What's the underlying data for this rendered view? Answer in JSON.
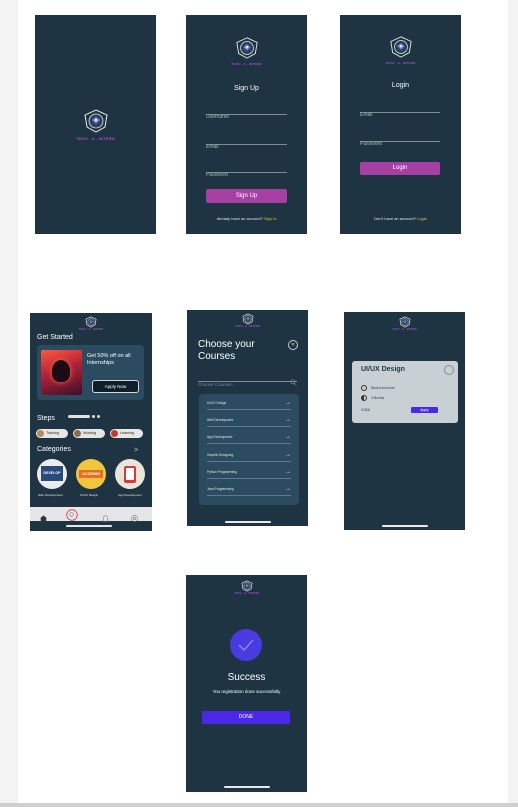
{
  "colors": {
    "background": "#f3f3f3",
    "screen": "#1f3443",
    "card": "#2b4c60",
    "brand_purple": "#a64ecf",
    "primary_button": "#a63fa4",
    "link_yellow": "#e9c32e",
    "accent_blue": "#4a29e6"
  },
  "splash": {
    "brand": "TECH - A - INTERN"
  },
  "signup": {
    "brand": "TECH - A - INTERN",
    "title": "Sign Up",
    "username_placeholder": "Username",
    "email_placeholder": "Email",
    "password_placeholder": "Password",
    "button": "Sign Up",
    "footer_text": "Already have an account?",
    "footer_link": "Sign In"
  },
  "login": {
    "brand": "TECH - A - INTERN",
    "title": "Login",
    "email_placeholder": "Email",
    "password_placeholder": "Password",
    "button": "Login",
    "footer_text": "Don't have an account?",
    "footer_link": "Login"
  },
  "home": {
    "brand": "TECH - A - INTERN",
    "get_started": "Get Started",
    "promo_text": "Get 50% off on all Internships",
    "apply_now": "Apply Now",
    "steps_title": "Steps",
    "steps": [
      {
        "label": "Training"
      },
      {
        "label": "Working"
      },
      {
        "label": "Learning"
      }
    ],
    "categories_title": "Categories",
    "categories_arrow": ">",
    "categories": [
      {
        "label": "Web Development",
        "image_text": "DEVELOP"
      },
      {
        "label": "UI/UX Design",
        "image_text": "UX DESIGN"
      },
      {
        "label": "App Development",
        "image_text": ""
      }
    ],
    "tabs": [
      {
        "icon": "home-icon"
      },
      {
        "icon": "search-icon"
      },
      {
        "icon": "bell-icon"
      },
      {
        "icon": "settings-icon"
      }
    ]
  },
  "choose_courses": {
    "brand": "TECH - A - INTERN",
    "title": "Choose your Courses",
    "search_placeholder": "Choose Courses...",
    "courses": [
      {
        "label": "UI/UX Design"
      },
      {
        "label": "Web Development"
      },
      {
        "label": "App Development"
      },
      {
        "label": "Graphic Designing"
      },
      {
        "label": "Python Programming"
      },
      {
        "label": "Java Programming"
      }
    ],
    "arrow": "→"
  },
  "course_detail": {
    "brand": "TECH - A - INTERN",
    "title": "UI/UX Design",
    "mode": "Work from home",
    "duration": "3 Months",
    "price": "₹1500",
    "apply": "Apply"
  },
  "success": {
    "brand": "TECH - A - INTERN",
    "title": "Success",
    "message": "You registration done successfully",
    "button": "DONE"
  }
}
